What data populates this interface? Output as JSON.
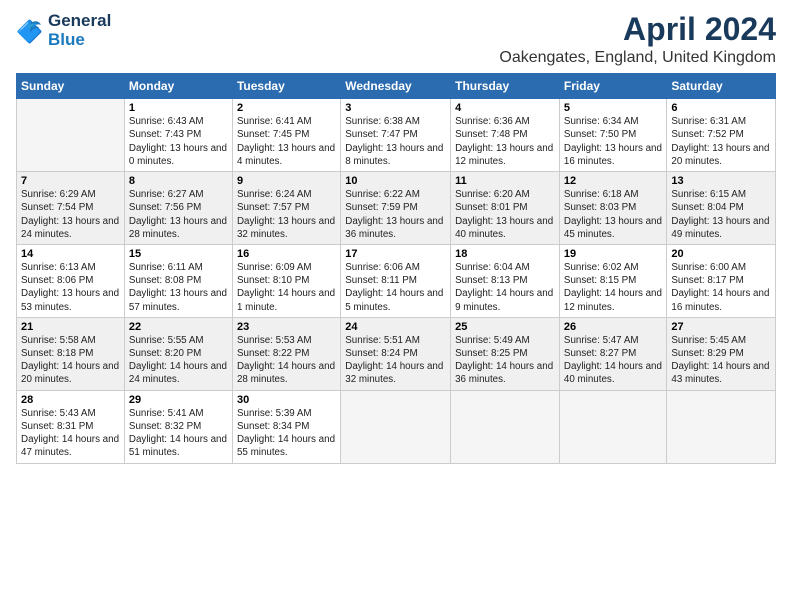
{
  "header": {
    "logo_line1": "General",
    "logo_line2": "Blue",
    "title": "April 2024",
    "subtitle": "Oakengates, England, United Kingdom"
  },
  "days_of_week": [
    "Sunday",
    "Monday",
    "Tuesday",
    "Wednesday",
    "Thursday",
    "Friday",
    "Saturday"
  ],
  "weeks": [
    [
      {
        "day": "",
        "sunrise": "",
        "sunset": "",
        "daylight": ""
      },
      {
        "day": "1",
        "sunrise": "Sunrise: 6:43 AM",
        "sunset": "Sunset: 7:43 PM",
        "daylight": "Daylight: 13 hours and 0 minutes."
      },
      {
        "day": "2",
        "sunrise": "Sunrise: 6:41 AM",
        "sunset": "Sunset: 7:45 PM",
        "daylight": "Daylight: 13 hours and 4 minutes."
      },
      {
        "day": "3",
        "sunrise": "Sunrise: 6:38 AM",
        "sunset": "Sunset: 7:47 PM",
        "daylight": "Daylight: 13 hours and 8 minutes."
      },
      {
        "day": "4",
        "sunrise": "Sunrise: 6:36 AM",
        "sunset": "Sunset: 7:48 PM",
        "daylight": "Daylight: 13 hours and 12 minutes."
      },
      {
        "day": "5",
        "sunrise": "Sunrise: 6:34 AM",
        "sunset": "Sunset: 7:50 PM",
        "daylight": "Daylight: 13 hours and 16 minutes."
      },
      {
        "day": "6",
        "sunrise": "Sunrise: 6:31 AM",
        "sunset": "Sunset: 7:52 PM",
        "daylight": "Daylight: 13 hours and 20 minutes."
      }
    ],
    [
      {
        "day": "7",
        "sunrise": "Sunrise: 6:29 AM",
        "sunset": "Sunset: 7:54 PM",
        "daylight": "Daylight: 13 hours and 24 minutes."
      },
      {
        "day": "8",
        "sunrise": "Sunrise: 6:27 AM",
        "sunset": "Sunset: 7:56 PM",
        "daylight": "Daylight: 13 hours and 28 minutes."
      },
      {
        "day": "9",
        "sunrise": "Sunrise: 6:24 AM",
        "sunset": "Sunset: 7:57 PM",
        "daylight": "Daylight: 13 hours and 32 minutes."
      },
      {
        "day": "10",
        "sunrise": "Sunrise: 6:22 AM",
        "sunset": "Sunset: 7:59 PM",
        "daylight": "Daylight: 13 hours and 36 minutes."
      },
      {
        "day": "11",
        "sunrise": "Sunrise: 6:20 AM",
        "sunset": "Sunset: 8:01 PM",
        "daylight": "Daylight: 13 hours and 40 minutes."
      },
      {
        "day": "12",
        "sunrise": "Sunrise: 6:18 AM",
        "sunset": "Sunset: 8:03 PM",
        "daylight": "Daylight: 13 hours and 45 minutes."
      },
      {
        "day": "13",
        "sunrise": "Sunrise: 6:15 AM",
        "sunset": "Sunset: 8:04 PM",
        "daylight": "Daylight: 13 hours and 49 minutes."
      }
    ],
    [
      {
        "day": "14",
        "sunrise": "Sunrise: 6:13 AM",
        "sunset": "Sunset: 8:06 PM",
        "daylight": "Daylight: 13 hours and 53 minutes."
      },
      {
        "day": "15",
        "sunrise": "Sunrise: 6:11 AM",
        "sunset": "Sunset: 8:08 PM",
        "daylight": "Daylight: 13 hours and 57 minutes."
      },
      {
        "day": "16",
        "sunrise": "Sunrise: 6:09 AM",
        "sunset": "Sunset: 8:10 PM",
        "daylight": "Daylight: 14 hours and 1 minute."
      },
      {
        "day": "17",
        "sunrise": "Sunrise: 6:06 AM",
        "sunset": "Sunset: 8:11 PM",
        "daylight": "Daylight: 14 hours and 5 minutes."
      },
      {
        "day": "18",
        "sunrise": "Sunrise: 6:04 AM",
        "sunset": "Sunset: 8:13 PM",
        "daylight": "Daylight: 14 hours and 9 minutes."
      },
      {
        "day": "19",
        "sunrise": "Sunrise: 6:02 AM",
        "sunset": "Sunset: 8:15 PM",
        "daylight": "Daylight: 14 hours and 12 minutes."
      },
      {
        "day": "20",
        "sunrise": "Sunrise: 6:00 AM",
        "sunset": "Sunset: 8:17 PM",
        "daylight": "Daylight: 14 hours and 16 minutes."
      }
    ],
    [
      {
        "day": "21",
        "sunrise": "Sunrise: 5:58 AM",
        "sunset": "Sunset: 8:18 PM",
        "daylight": "Daylight: 14 hours and 20 minutes."
      },
      {
        "day": "22",
        "sunrise": "Sunrise: 5:55 AM",
        "sunset": "Sunset: 8:20 PM",
        "daylight": "Daylight: 14 hours and 24 minutes."
      },
      {
        "day": "23",
        "sunrise": "Sunrise: 5:53 AM",
        "sunset": "Sunset: 8:22 PM",
        "daylight": "Daylight: 14 hours and 28 minutes."
      },
      {
        "day": "24",
        "sunrise": "Sunrise: 5:51 AM",
        "sunset": "Sunset: 8:24 PM",
        "daylight": "Daylight: 14 hours and 32 minutes."
      },
      {
        "day": "25",
        "sunrise": "Sunrise: 5:49 AM",
        "sunset": "Sunset: 8:25 PM",
        "daylight": "Daylight: 14 hours and 36 minutes."
      },
      {
        "day": "26",
        "sunrise": "Sunrise: 5:47 AM",
        "sunset": "Sunset: 8:27 PM",
        "daylight": "Daylight: 14 hours and 40 minutes."
      },
      {
        "day": "27",
        "sunrise": "Sunrise: 5:45 AM",
        "sunset": "Sunset: 8:29 PM",
        "daylight": "Daylight: 14 hours and 43 minutes."
      }
    ],
    [
      {
        "day": "28",
        "sunrise": "Sunrise: 5:43 AM",
        "sunset": "Sunset: 8:31 PM",
        "daylight": "Daylight: 14 hours and 47 minutes."
      },
      {
        "day": "29",
        "sunrise": "Sunrise: 5:41 AM",
        "sunset": "Sunset: 8:32 PM",
        "daylight": "Daylight: 14 hours and 51 minutes."
      },
      {
        "day": "30",
        "sunrise": "Sunrise: 5:39 AM",
        "sunset": "Sunset: 8:34 PM",
        "daylight": "Daylight: 14 hours and 55 minutes."
      },
      {
        "day": "",
        "sunrise": "",
        "sunset": "",
        "daylight": ""
      },
      {
        "day": "",
        "sunrise": "",
        "sunset": "",
        "daylight": ""
      },
      {
        "day": "",
        "sunrise": "",
        "sunset": "",
        "daylight": ""
      },
      {
        "day": "",
        "sunrise": "",
        "sunset": "",
        "daylight": ""
      }
    ]
  ]
}
